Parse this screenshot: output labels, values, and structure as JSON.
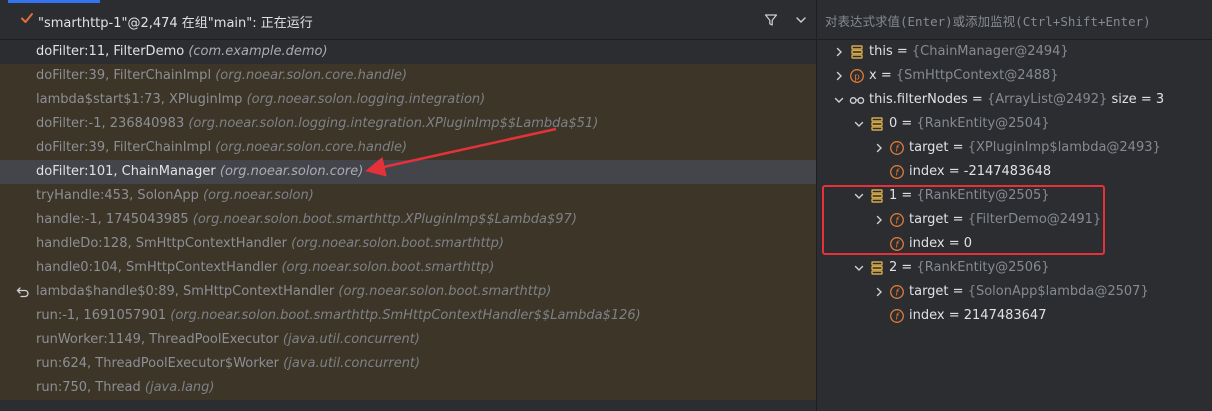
{
  "thread": {
    "title": "\"smarthttp-1\"@2,474 在组\"main\": 正在运行"
  },
  "frames": [
    {
      "method": "doFilter:11, FilterDemo",
      "pkg": "(com.example.demo)",
      "kind": "current"
    },
    {
      "method": "doFilter:39, FilterChainImpl",
      "pkg": "(org.noear.solon.core.handle)",
      "kind": "library"
    },
    {
      "method": "lambda$start$1:73, XPluginImp",
      "pkg": "(org.noear.solon.logging.integration)",
      "kind": "library"
    },
    {
      "method": "doFilter:-1, 236840983",
      "pkg": "(org.noear.solon.logging.integration.XPluginImp$$Lambda$51)",
      "kind": "library"
    },
    {
      "method": "doFilter:39, FilterChainImpl",
      "pkg": "(org.noear.solon.core.handle)",
      "kind": "library"
    },
    {
      "method": "doFilter:101, ChainManager",
      "pkg": "(org.noear.solon.core)",
      "kind": "selected"
    },
    {
      "method": "tryHandle:453, SolonApp",
      "pkg": "(org.noear.solon)",
      "kind": "library"
    },
    {
      "method": "handle:-1, 1745043985",
      "pkg": "(org.noear.solon.boot.smarthttp.XPluginImp$$Lambda$97)",
      "kind": "library"
    },
    {
      "method": "handleDo:128, SmHttpContextHandler",
      "pkg": "(org.noear.solon.boot.smarthttp)",
      "kind": "library"
    },
    {
      "method": "handle0:104, SmHttpContextHandler",
      "pkg": "(org.noear.solon.boot.smarthttp)",
      "kind": "library"
    },
    {
      "method": "lambda$handle$0:89, SmHttpContextHandler",
      "pkg": "(org.noear.solon.boot.smarthttp)",
      "kind": "library",
      "icon": "async-return-icon"
    },
    {
      "method": "run:-1, 1691057901",
      "pkg": "(org.noear.solon.boot.smarthttp.SmHttpContextHandler$$Lambda$126)",
      "kind": "library"
    },
    {
      "method": "runWorker:1149, ThreadPoolExecutor",
      "pkg": "(java.util.concurrent)",
      "kind": "library"
    },
    {
      "method": "run:624, ThreadPoolExecutor$Worker",
      "pkg": "(java.util.concurrent)",
      "kind": "library"
    },
    {
      "method": "run:750, Thread",
      "pkg": "(java.lang)",
      "kind": "library"
    }
  ],
  "watch": {
    "placeholder": "对表达式求值(Enter)或添加监视(Ctrl+Shift+Enter)"
  },
  "variables": [
    {
      "depth": 0,
      "chevron": "right",
      "icon": "field-icon",
      "name": "this",
      "eq": " = ",
      "ref": "{ChainManager@2494}",
      "extra": ""
    },
    {
      "depth": 0,
      "chevron": "right",
      "icon": "parameter-icon",
      "name": "x",
      "eq": " = ",
      "ref": "{SmHttpContext@2488}",
      "extra": ""
    },
    {
      "depth": 0,
      "chevron": "down",
      "icon": "watch-icon",
      "name": "this.filterNodes",
      "eq": " = ",
      "ref": "{ArrayList@2492}",
      "extra": "  size = 3"
    },
    {
      "depth": 1,
      "chevron": "down",
      "icon": "field-icon",
      "name": "0",
      "eq": " = ",
      "ref": "{RankEntity@2504}",
      "extra": ""
    },
    {
      "depth": 2,
      "chevron": "right",
      "icon": "final-field-icon",
      "name": "target",
      "eq": " = ",
      "ref": "{XPluginImp$lambda@2493}",
      "extra": ""
    },
    {
      "depth": 2,
      "chevron": "",
      "icon": "final-field-icon",
      "name": "index",
      "eq": " = ",
      "ref": "",
      "extra": "-2147483648"
    },
    {
      "depth": 1,
      "chevron": "down",
      "icon": "field-icon",
      "name": "1",
      "eq": " = ",
      "ref": "{RankEntity@2505}",
      "extra": ""
    },
    {
      "depth": 2,
      "chevron": "right",
      "icon": "final-field-icon",
      "name": "target",
      "eq": " = ",
      "ref": "{FilterDemo@2491}",
      "extra": ""
    },
    {
      "depth": 2,
      "chevron": "",
      "icon": "final-field-icon",
      "name": "index",
      "eq": " = ",
      "ref": "",
      "extra": "0"
    },
    {
      "depth": 1,
      "chevron": "down",
      "icon": "field-icon",
      "name": "2",
      "eq": " = ",
      "ref": "{RankEntity@2506}",
      "extra": ""
    },
    {
      "depth": 2,
      "chevron": "right",
      "icon": "final-field-icon",
      "name": "target",
      "eq": " = ",
      "ref": "{SolonApp$lambda@2507}",
      "extra": ""
    },
    {
      "depth": 2,
      "chevron": "",
      "icon": "final-field-icon",
      "name": "index",
      "eq": " = ",
      "ref": "",
      "extra": "2147483647"
    }
  ],
  "colors": {
    "background": "#2b2d30",
    "library_frame": "#3d3527",
    "selected_frame": "#43454a",
    "accent": "#3574f0",
    "check": "#e0703a",
    "annotation_red": "#e5323a",
    "field_icon": "#d6a94b",
    "final_icon": "#e07b39",
    "parameter_icon": "#e07b39"
  }
}
